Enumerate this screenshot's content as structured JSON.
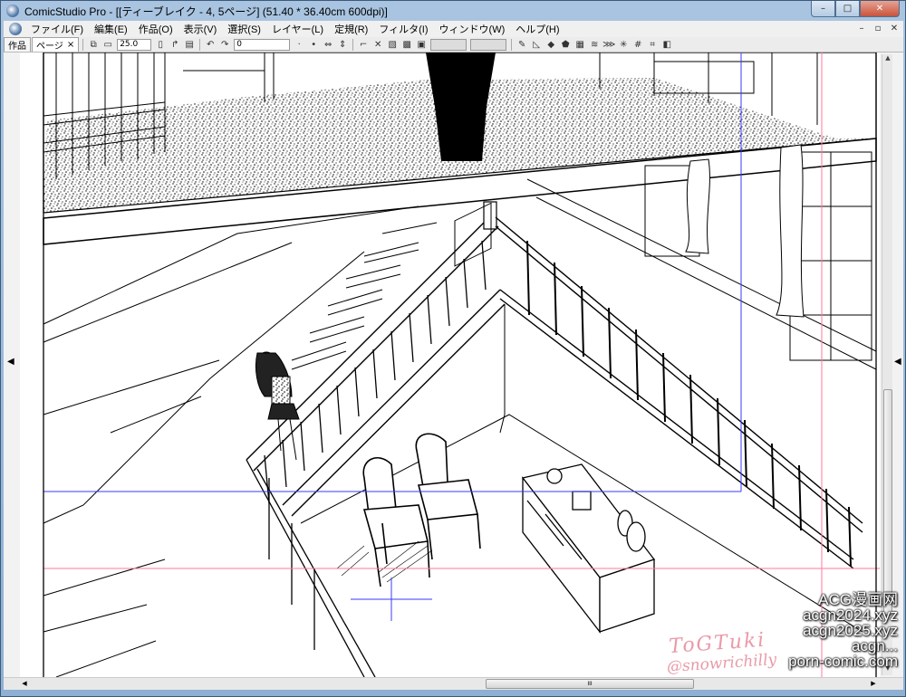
{
  "window": {
    "title": "ComicStudio Pro - [[ティーブレイク - 4, 5ページ] (51.40 * 36.40cm 600dpi)]",
    "controls": {
      "minimize": "–",
      "maximize": "□",
      "close": "✕"
    }
  },
  "menu": {
    "items": [
      "ファイル(F)",
      "編集(E)",
      "作品(O)",
      "表示(V)",
      "選択(S)",
      "レイヤー(L)",
      "定規(R)",
      "フィルタ(I)",
      "ウィンドウ(W)",
      "ヘルプ(H)"
    ],
    "mdi_controls": [
      "–",
      "▫",
      "✕"
    ]
  },
  "toolbar": {
    "tabs": [
      {
        "label": "作品",
        "close": ""
      },
      {
        "label": "ページ",
        "close": "×"
      }
    ],
    "zoom_value": "25.0",
    "rotation_value": "0"
  },
  "workspace": {
    "left_arrow": "◀",
    "right_arrow": "◀",
    "scroll_grip": "III"
  },
  "overlay": {
    "watermark": [
      "ACG漫画网",
      "acgn2024.xyz",
      "acgn2025.xyz",
      "acgn...",
      "porn-comic.com"
    ],
    "signature": [
      "ToGTuki",
      "@snowrichilly"
    ]
  },
  "colors": {
    "titlebar": "#a9c4e0",
    "guide_blue": "#3a3aff",
    "guide_pink": "#ff7a9a",
    "signature_pink": "#e99aa8"
  }
}
